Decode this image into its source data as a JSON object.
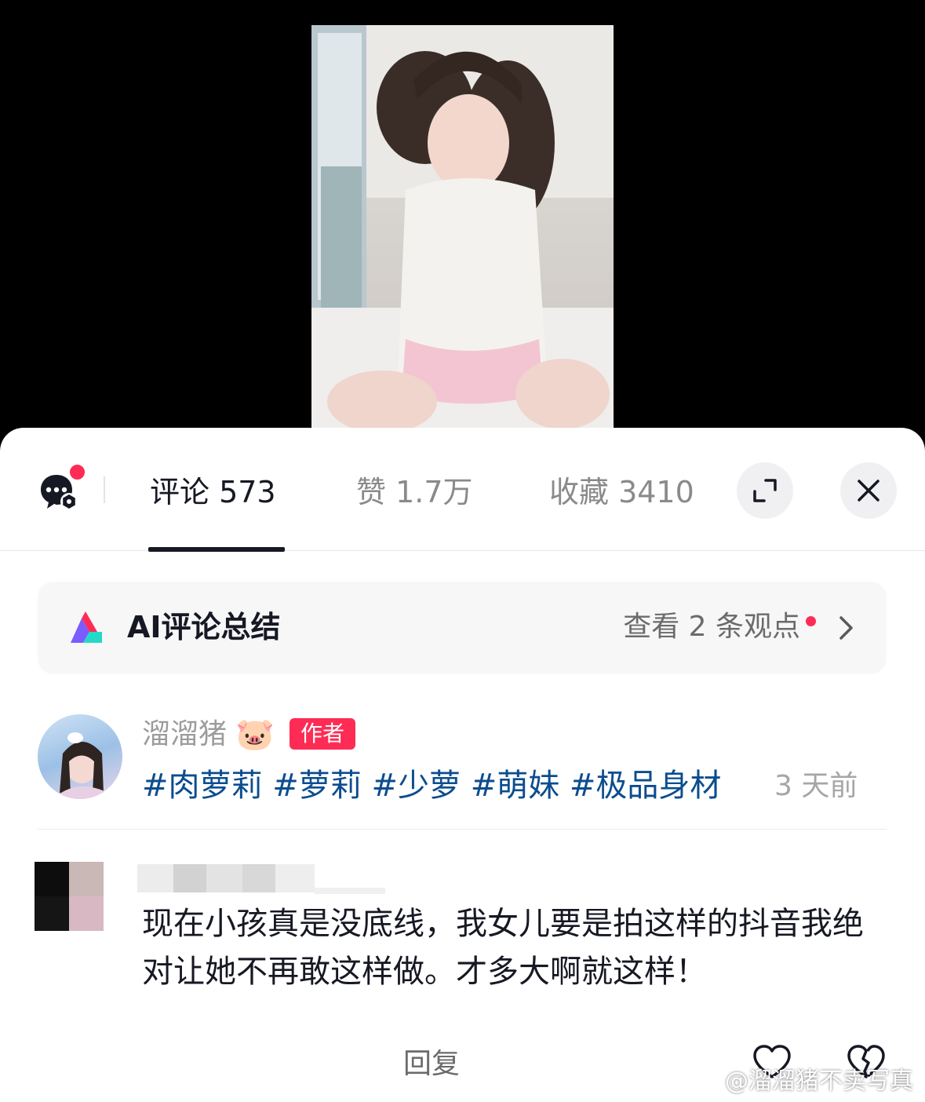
{
  "tabs": [
    {
      "label": "评论 573"
    },
    {
      "label": "赞 1.7万"
    },
    {
      "label": "收藏 3410"
    }
  ],
  "ai_summary": {
    "title": "AI评论总结",
    "link": "查看 2 条观点"
  },
  "author_post": {
    "name": "溜溜猪",
    "emoji": "🐷",
    "badge": "作者",
    "hashtags": "#肉萝莉 #萝莉 #少萝 #萌妹 #极品身材",
    "time": "3 天前"
  },
  "comment": {
    "text": "现在小孩真是没底线，我女儿要是拍这样的抖音我绝对让她不再敢这样做。才多大啊就这样！",
    "reply_label": "回复"
  },
  "watermark": "@溜溜猪不卖写真",
  "colors": {
    "accent": "#fe2c55",
    "hashtag": "#0b4d8f",
    "text_primary": "#161823",
    "text_secondary": "#8a8a8a"
  }
}
